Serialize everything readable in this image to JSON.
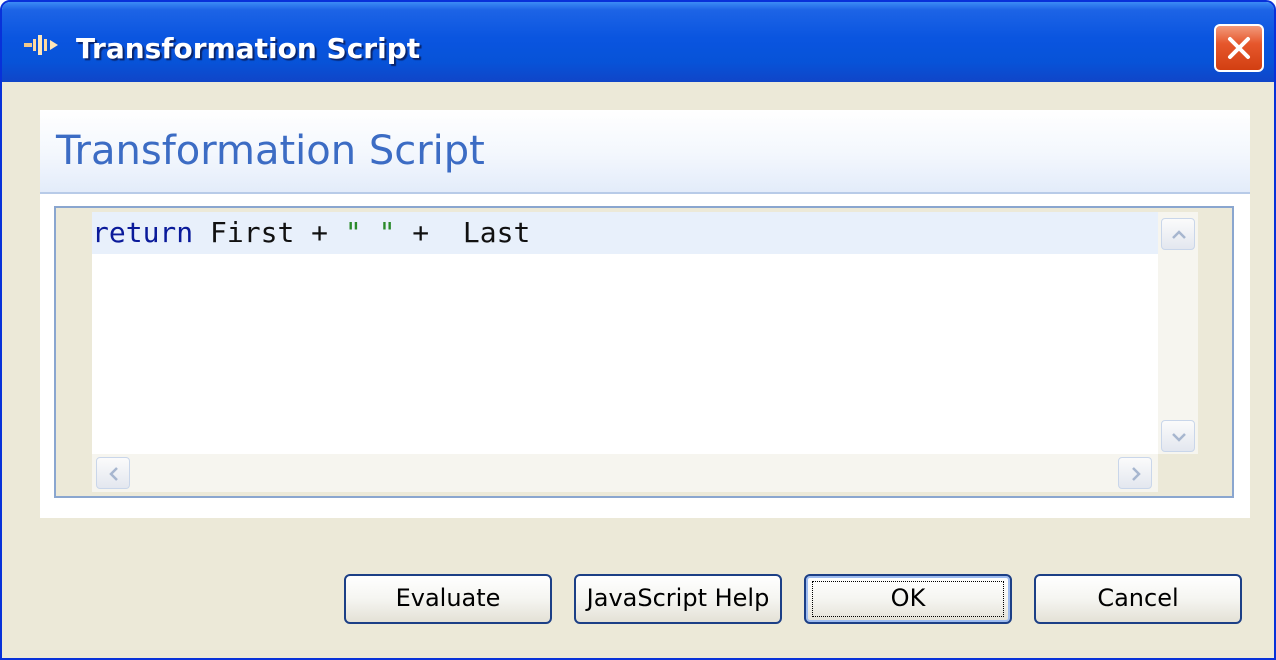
{
  "window": {
    "title": "Transformation Script",
    "app_icon": "flow-icon",
    "close_icon": "close-icon",
    "title_color": "#ffffff",
    "titlebar_color": "#0a55e0",
    "close_color": "#e6572c"
  },
  "panel": {
    "header": "Transformation Script",
    "header_color": "#3c6cc4"
  },
  "editor": {
    "code": {
      "keyword": "return",
      "part1": " First + ",
      "string": "\" \"",
      "part2": " +  Last"
    },
    "keyword_color": "#0a1a9a",
    "string_color": "#2a8a2a",
    "current_line_color": "#e8f0fb",
    "scroll_icons": {
      "up": "chevron-up-icon",
      "down": "chevron-down-icon",
      "left": "chevron-left-icon",
      "right": "chevron-right-icon"
    }
  },
  "buttons": {
    "evaluate": "Evaluate",
    "javascript_help": "JavaScript Help",
    "ok": "OK",
    "cancel": "Cancel"
  }
}
